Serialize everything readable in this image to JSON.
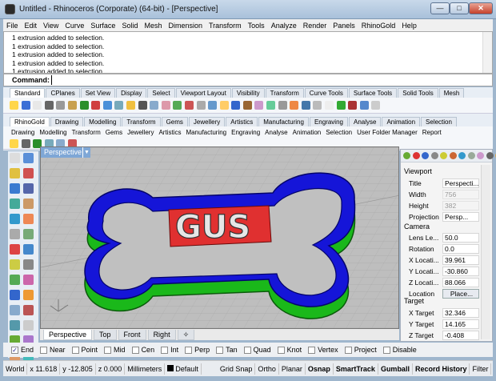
{
  "window": {
    "title": "Untitled - Rhinoceros (Corporate) (64-bit) - [Perspective]",
    "min": "—",
    "max": "□",
    "close": "✕"
  },
  "menu": [
    "File",
    "Edit",
    "View",
    "Curve",
    "Surface",
    "Solid",
    "Mesh",
    "Dimension",
    "Transform",
    "Tools",
    "Analyze",
    "Render",
    "Panels",
    "RhinoGold",
    "Help"
  ],
  "history": [
    "1 extrusion added to selection.",
    "1 extrusion added to selection.",
    "1 extrusion added to selection.",
    "1 extrusion added to selection.",
    "1 extrusion added to selection."
  ],
  "command": {
    "label": "Command:",
    "value": ""
  },
  "toolbar_tabs": [
    "Standard",
    "CPlanes",
    "Set View",
    "Display",
    "Select",
    "Viewport Layout",
    "Visibility",
    "Transform",
    "Curve Tools",
    "Surface Tools",
    "Solid Tools",
    "Mesh"
  ],
  "rhinogold_tabs": [
    "RhinoGold",
    "Drawing",
    "Modelling",
    "Transform",
    "Gems",
    "Jewellery",
    "Artistics",
    "Manufacturing",
    "Engraving",
    "Analyse",
    "Animation",
    "Selection"
  ],
  "rhinogold_buttons": [
    "Drawing",
    "Modelling",
    "Transform",
    "Gems",
    "Jewellery",
    "Artistics",
    "Manufacturing",
    "Engraving",
    "Analyse",
    "Animation",
    "Selection",
    "User Folder Manager",
    "Report"
  ],
  "viewport": {
    "label": "Perspective",
    "dropdown": "▼",
    "model_text": "GUS",
    "colors": {
      "cutter": "#1010d0",
      "base": "#22d022",
      "plate": "#e03030"
    }
  },
  "viewport_tabs": [
    "Perspective",
    "Top",
    "Front",
    "Right",
    "✧"
  ],
  "panel": {
    "viewport_heading": "Viewport",
    "viewport_rows": [
      {
        "label": "Title",
        "value": "Perspecti..."
      },
      {
        "label": "Width",
        "value": "756"
      },
      {
        "label": "Height",
        "value": "382"
      },
      {
        "label": "Projection",
        "value": "Persp..."
      }
    ],
    "camera_heading": "Camera",
    "camera_rows": [
      {
        "label": "Lens Le...",
        "value": "50.0"
      },
      {
        "label": "Rotation",
        "value": "0.0"
      },
      {
        "label": "X Locati...",
        "value": "39.961"
      },
      {
        "label": "Y Locati...",
        "value": "-30.860"
      },
      {
        "label": "Z Locati...",
        "value": "88.066"
      },
      {
        "label": "Location",
        "value": "Place..."
      }
    ],
    "target_heading": "Target",
    "target_rows": [
      {
        "label": "X Target",
        "value": "32.346"
      },
      {
        "label": "Y Target",
        "value": "14.165"
      },
      {
        "label": "Z Target",
        "value": "-0.408"
      }
    ]
  },
  "osnaps": [
    {
      "label": "End",
      "checked": true
    },
    {
      "label": "Near",
      "checked": false
    },
    {
      "label": "Point",
      "checked": false
    },
    {
      "label": "Mid",
      "checked": false
    },
    {
      "label": "Cen",
      "checked": false
    },
    {
      "label": "Int",
      "checked": false
    },
    {
      "label": "Perp",
      "checked": false
    },
    {
      "label": "Tan",
      "checked": false
    },
    {
      "label": "Quad",
      "checked": false
    },
    {
      "label": "Knot",
      "checked": false
    },
    {
      "label": "Vertex",
      "checked": false
    },
    {
      "label": "Project",
      "checked": false
    },
    {
      "label": "Disable",
      "checked": false
    }
  ],
  "status": {
    "cplane": "World",
    "x": "x 11.618",
    "y": "y -12.805",
    "z": "z 0.000",
    "units": "Millimeters",
    "layer": "Default",
    "grid_snap": "Grid Snap",
    "ortho": "Ortho",
    "planar": "Planar",
    "osnap": "Osnap",
    "smarttrack": "SmartTrack",
    "gumball": "Gumball",
    "record_history": "Record History",
    "filter": "Filter"
  }
}
